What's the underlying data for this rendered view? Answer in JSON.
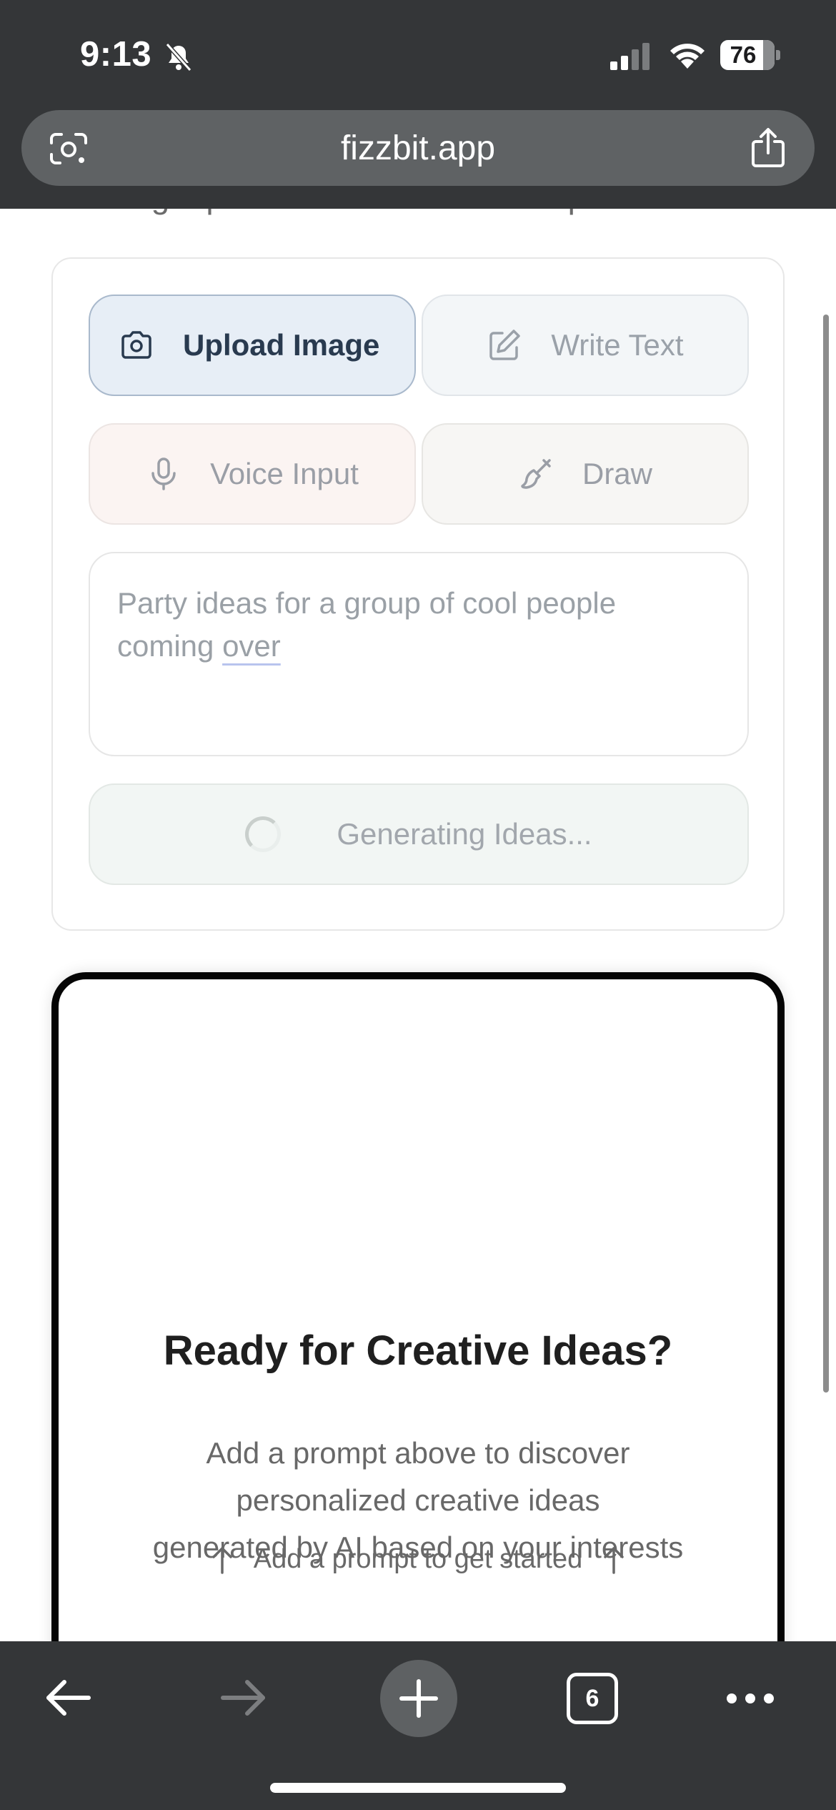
{
  "status_bar": {
    "time": "9:13",
    "battery_level": "76",
    "icons": [
      "bell-slash-icon",
      "cellular-signal-icon",
      "wifi-icon",
      "battery-icon"
    ]
  },
  "browser": {
    "url": "fizzbit.app",
    "open_tabs_count": "6",
    "icons": [
      "google-lens-icon",
      "share-icon",
      "back-arrow-icon",
      "forward-arrow-icon",
      "plus-icon",
      "more-dots-icon"
    ]
  },
  "page": {
    "clipped_subtitle": "get personalized creative inspiration.",
    "input_modes": [
      {
        "label": "Upload Image",
        "icon": "camera-icon",
        "selected": true
      },
      {
        "label": "Write Text",
        "icon": "pencil-square-icon",
        "selected": false
      },
      {
        "label": "Voice Input",
        "icon": "microphone-icon",
        "selected": false
      },
      {
        "label": "Draw",
        "icon": "paintbrush-icon",
        "selected": false
      }
    ],
    "prompt": {
      "text_start": "Party ideas for a group of cool people coming ",
      "text_underlined": "over"
    },
    "generate_button": {
      "label": "Generating Ideas...",
      "icon": "spinner-icon"
    },
    "results": {
      "title": "Ready for Creative Ideas?",
      "body": "Add a prompt above to discover\npersonalized creative ideas\ngenerated by AI based on your interests",
      "hint": "Add a prompt to get started"
    }
  },
  "colors": {
    "chrome_background": "#343638",
    "url_bar": "#5f6264",
    "selected_mode_bg": "#e7eef6",
    "selected_mode_text": "#293a4f",
    "result_card_border": "#050505"
  }
}
